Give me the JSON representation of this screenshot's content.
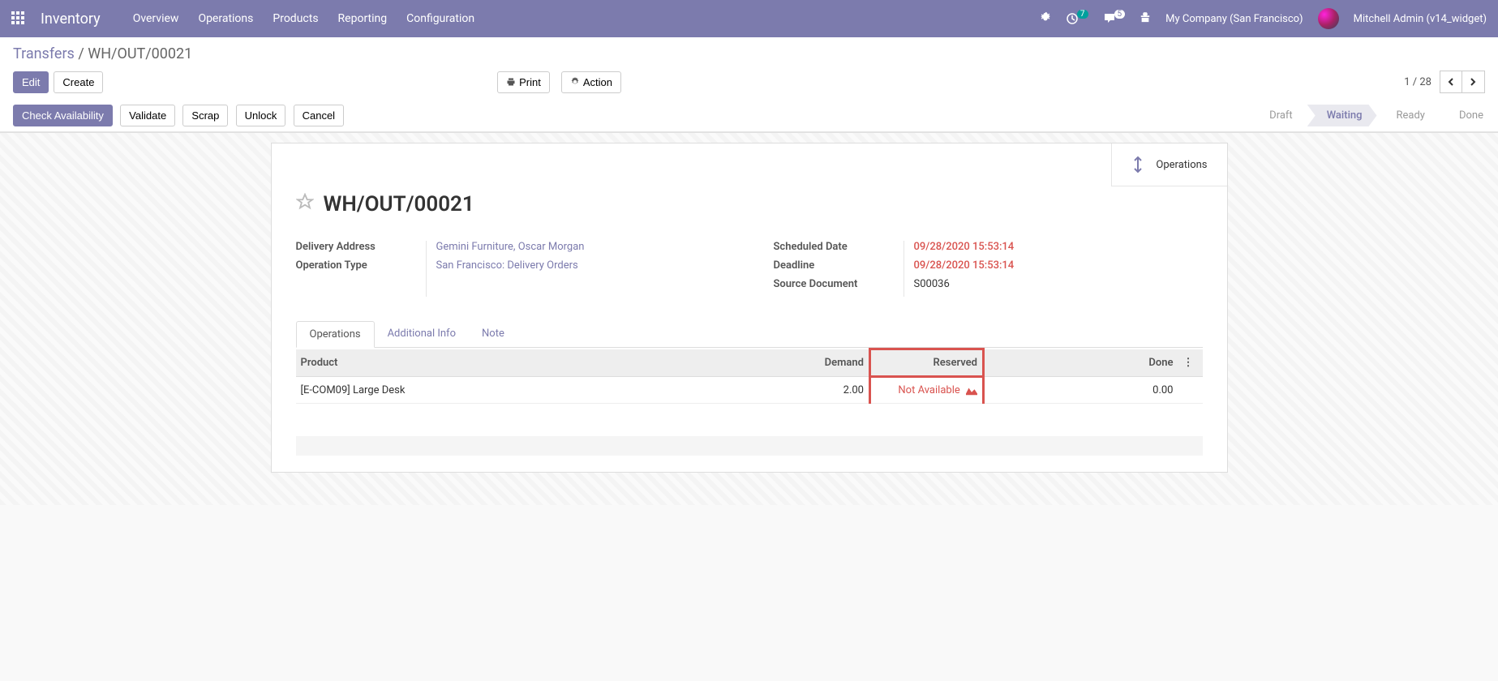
{
  "navbar": {
    "brand": "Inventory",
    "menu": [
      "Overview",
      "Operations",
      "Products",
      "Reporting",
      "Configuration"
    ],
    "activity_count": "7",
    "message_count": "5",
    "company": "My Company (San Francisco)",
    "user": "Mitchell Admin (v14_widget)"
  },
  "breadcrumb": {
    "parent": "Transfers",
    "current": "WH/OUT/00021"
  },
  "buttons": {
    "edit": "Edit",
    "create": "Create",
    "print": "Print",
    "action": "Action",
    "check": "Check Availability",
    "validate": "Validate",
    "scrap": "Scrap",
    "unlock": "Unlock",
    "cancel": "Cancel"
  },
  "pager": {
    "text": "1 / 28"
  },
  "status": {
    "draft": "Draft",
    "waiting": "Waiting",
    "ready": "Ready",
    "done": "Done"
  },
  "stat_button": {
    "label": "Operations"
  },
  "record": {
    "name": "WH/OUT/00021",
    "delivery_address_label": "Delivery Address",
    "delivery_address": "Gemini Furniture, Oscar Morgan",
    "operation_type_label": "Operation Type",
    "operation_type": "San Francisco: Delivery Orders",
    "scheduled_label": "Scheduled Date",
    "scheduled": "09/28/2020 15:53:14",
    "deadline_label": "Deadline",
    "deadline": "09/28/2020 15:53:14",
    "source_label": "Source Document",
    "source": "S00036"
  },
  "tabs": {
    "operations": "Operations",
    "additional": "Additional Info",
    "note": "Note"
  },
  "table": {
    "headers": {
      "product": "Product",
      "demand": "Demand",
      "reserved": "Reserved",
      "done": "Done"
    },
    "rows": [
      {
        "product": "[E-COM09] Large Desk",
        "demand": "2.00",
        "reserved": "Not Available",
        "done": "0.00"
      }
    ]
  }
}
